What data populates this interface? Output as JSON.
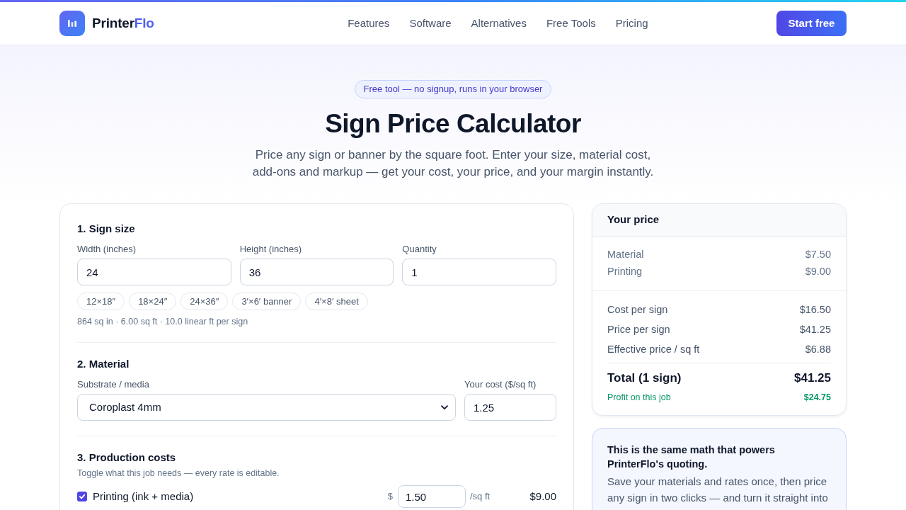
{
  "header": {
    "brand": {
      "name": "Printer",
      "accent": "Flo"
    },
    "nav": [
      {
        "label": "Features"
      },
      {
        "label": "Software"
      },
      {
        "label": "Alternatives"
      },
      {
        "label": "Free Tools"
      },
      {
        "label": "Pricing"
      }
    ],
    "cta": "Start free"
  },
  "hero": {
    "badge": "Free tool — no signup, runs in your browser",
    "title": "Sign Price Calculator",
    "subtitle": "Price any sign or banner by the square foot. Enter your size, material cost, add-ons and markup — get your cost, your price, and your margin instantly."
  },
  "calculator": {
    "size": {
      "heading": "1. Sign size",
      "fields": [
        {
          "label": "Width (inches)",
          "value": "24"
        },
        {
          "label": "Height (inches)",
          "value": "36"
        },
        {
          "label": "Quantity",
          "value": "1"
        }
      ],
      "presets": [
        "12×18″",
        "18×24″",
        "24×36″",
        "3′×6′ banner",
        "4′×8′ sheet"
      ],
      "summary": "864 sq in · 6.00 sq ft · 10.0 linear ft per sign"
    },
    "material": {
      "heading": "2. Material",
      "substrate": {
        "label": "Substrate / media",
        "value": "Coroplast 4mm"
      },
      "cost": {
        "label": "Your cost ($/sq ft)",
        "value": "1.25"
      }
    },
    "production": {
      "heading": "3. Production costs",
      "hint": "Toggle what this job needs — every rate is editable.",
      "items": [
        {
          "label": "Printing (ink + media)",
          "checked": true,
          "currency": "$",
          "rate": "1.50",
          "unit": "/sq ft",
          "amount": "$9.00"
        }
      ]
    }
  },
  "summary": {
    "title": "Your price",
    "breakdown": [
      {
        "label": "Material",
        "value": "$7.50"
      },
      {
        "label": "Printing",
        "value": "$9.00"
      }
    ],
    "metrics": [
      {
        "label": "Cost per sign",
        "value": "$16.50"
      },
      {
        "label": "Price per sign",
        "value": "$41.25"
      },
      {
        "label": "Effective price / sq ft",
        "value": "$6.88"
      }
    ],
    "total": {
      "label": "Total (1 sign)",
      "value": "$41.25"
    },
    "profit": {
      "label": "Profit on this job",
      "value": "$24.75"
    }
  },
  "promo": {
    "heading": "This is the same math that powers PrinterFlo's quoting.",
    "body": "Save your materials and rates once, then price any sign in two clicks — and turn it straight into"
  }
}
